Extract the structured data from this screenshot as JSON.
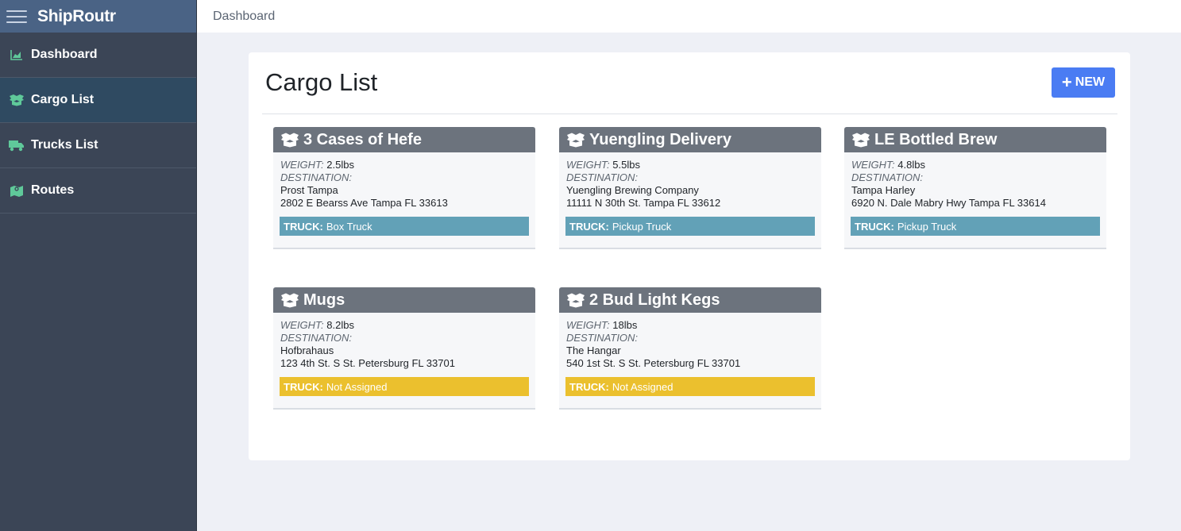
{
  "app": {
    "name": "ShipRoutr"
  },
  "sidebar": {
    "items": [
      {
        "label": "Dashboard",
        "icon": "area-chart-icon"
      },
      {
        "label": "Cargo List",
        "icon": "box-open-icon"
      },
      {
        "label": "Trucks List",
        "icon": "truck-icon"
      },
      {
        "label": "Routes",
        "icon": "map-icon"
      }
    ],
    "active": "Cargo List"
  },
  "header": {
    "breadcrumb": "Dashboard"
  },
  "main": {
    "title": "Cargo List",
    "new_button": "NEW",
    "weight_label": "WEIGHT:",
    "destination_label": "DESTINATION:",
    "truck_label": "TRUCK:",
    "cargo": [
      {
        "name": "3 Cases of Hefe",
        "weight": "2.5lbs",
        "dest_name": "Prost Tampa",
        "dest_address": "2802 E Bearss Ave Tampa FL 33613",
        "truck": "Box Truck",
        "status": "assigned"
      },
      {
        "name": "Yuengling Delivery",
        "weight": "5.5lbs",
        "dest_name": "Yuengling Brewing Company",
        "dest_address": "11111 N 30th St. Tampa FL 33612",
        "truck": "Pickup Truck",
        "status": "assigned"
      },
      {
        "name": "LE Bottled Brew",
        "weight": "4.8lbs",
        "dest_name": "Tampa Harley",
        "dest_address": "6920 N. Dale Mabry Hwy Tampa FL 33614",
        "truck": "Pickup Truck",
        "status": "assigned"
      },
      {
        "name": "Mugs",
        "weight": "8.2lbs",
        "dest_name": "Hofbrahaus",
        "dest_address": "123 4th St. S St. Petersburg FL 33701",
        "truck": "Not Assigned",
        "status": "unassigned"
      },
      {
        "name": "2 Bud Light Kegs",
        "weight": "18lbs",
        "dest_name": "The Hangar",
        "dest_address": "540 1st St. S St. Petersburg FL 33701",
        "truck": "Not Assigned",
        "status": "unassigned"
      }
    ]
  },
  "colors": {
    "sidebar_bg": "#3b4556",
    "brand_bg": "#4a6385",
    "accent": "#4a7cf3",
    "icon_green": "#5fc99a",
    "truck_assigned": "#62a1b7",
    "truck_unassigned": "#ebc02e",
    "card_header": "#6c737d"
  }
}
